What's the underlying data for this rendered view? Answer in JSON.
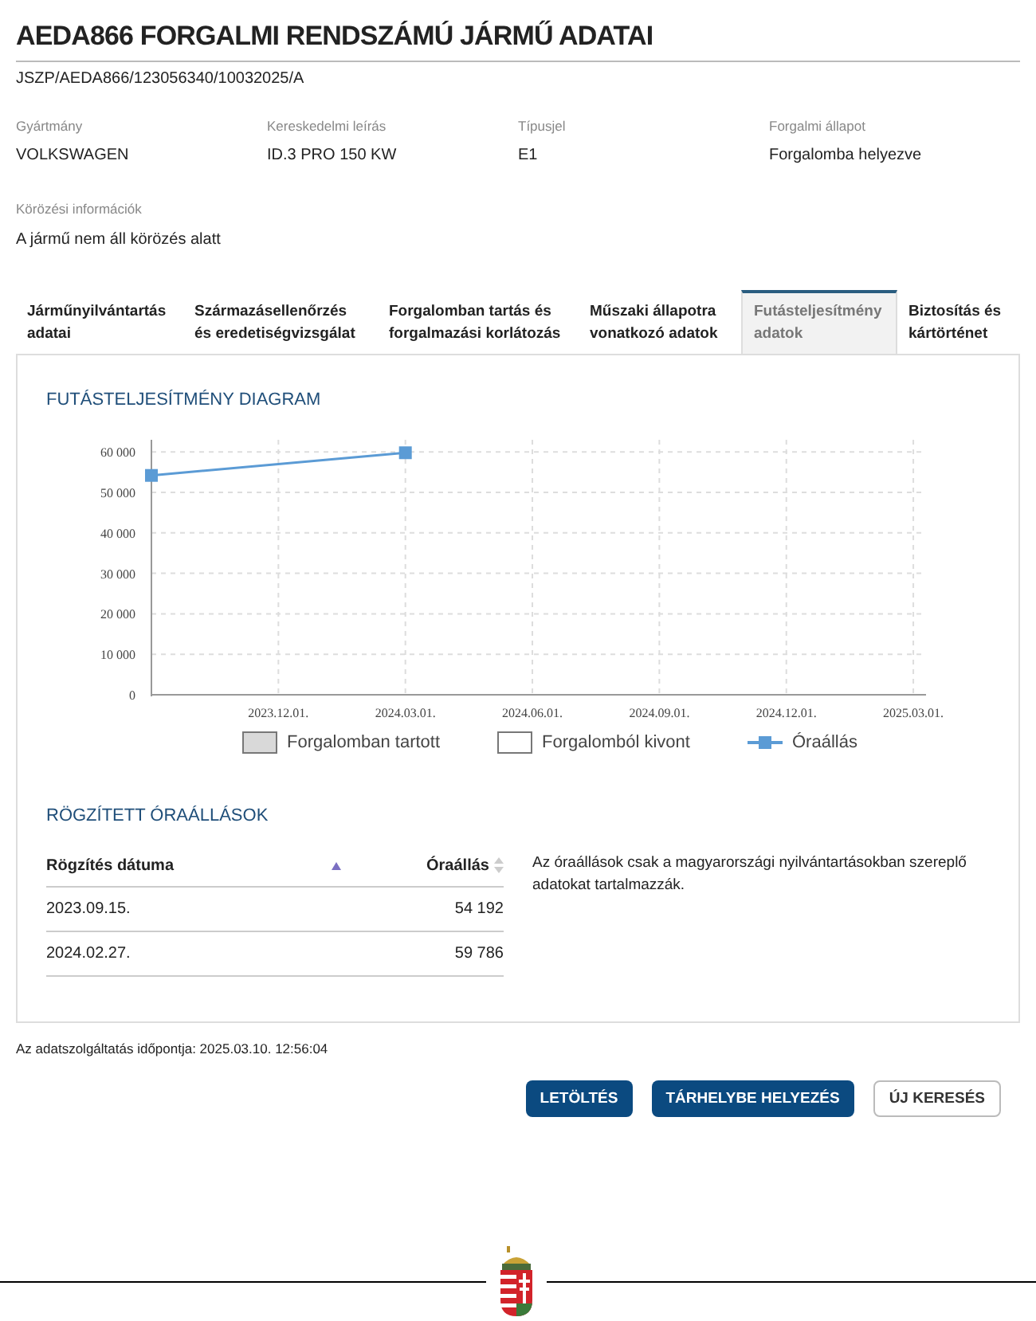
{
  "title": "AEDA866 FORGALMI RENDSZÁMÚ JÁRMŰ ADATAI",
  "reference": "JSZP/AEDA866/123056340/10032025/A",
  "fields": [
    {
      "label": "Gyártmány",
      "value": "VOLKSWAGEN"
    },
    {
      "label": "Kereskedelmi leírás",
      "value": "ID.3 PRO 150 KW"
    },
    {
      "label": "Típusjel",
      "value": "E1"
    },
    {
      "label": "Forgalmi állapot",
      "value": "Forgalomba helyezve"
    }
  ],
  "wanted_info": {
    "label": "Körözési információk",
    "value": "A jármű nem áll körözés alatt"
  },
  "tabs": [
    {
      "label": "Járműnyilvántartás adatai",
      "selected": false
    },
    {
      "label": "Származásellenőrzés és eredetiségvizsgálat",
      "selected": false
    },
    {
      "label": "Forgalomban tartás és forgalmazási korlátozás",
      "selected": false
    },
    {
      "label": "Műszaki állapotra vonatkozó adatok",
      "selected": false
    },
    {
      "label": "Futásteljesítmény adatok",
      "selected": true
    },
    {
      "label": "Biztosítás és kártörténet",
      "selected": false
    }
  ],
  "diagram": {
    "heading": "FUTÁSTELJESÍTMÉNY DIAGRAM",
    "legend": [
      {
        "label": "Forgalomban tartott",
        "kind": "filled"
      },
      {
        "label": "Forgalomból kivont",
        "kind": "outline"
      }
    ],
    "chart_data": {
      "type": "line",
      "grid": true,
      "categories": [
        null,
        null,
        null,
        "2023.12.01.",
        null,
        null,
        "2024.03.01.",
        null,
        null,
        "2024.06.01.",
        null,
        null,
        "2024.09.01.",
        null,
        null,
        "2024.12.01.",
        null,
        null,
        "2025.03.01."
      ],
      "ylim": [
        0,
        63000
      ],
      "yticks": [
        {
          "value": 0,
          "label": "0"
        },
        {
          "value": 10000,
          "label": "10 000"
        },
        {
          "value": 20000,
          "label": "20 000"
        },
        {
          "value": 30000,
          "label": "30 000"
        },
        {
          "value": 40000,
          "label": "40 000"
        },
        {
          "value": 50000,
          "label": "50 000"
        },
        {
          "value": 60000,
          "label": "60 000"
        }
      ],
      "series": [
        {
          "name": "Óraállás",
          "color": "#5b9bd5",
          "marker": "square",
          "values": [
            54200,
            null,
            null,
            null,
            null,
            null,
            59800,
            null,
            null,
            null,
            null,
            null,
            null,
            null,
            null,
            null,
            null,
            null,
            null
          ]
        }
      ]
    }
  },
  "readings": {
    "heading": "RÖGZÍTETT ÓRAÁLLÁSOK",
    "columns": [
      {
        "label": "Rögzítés dátuma",
        "sorted": true
      },
      {
        "label": "Óraállás",
        "sorted": false
      }
    ],
    "rows": [
      [
        "2023.09.15.",
        "54 192"
      ],
      [
        "2024.02.27.",
        "59 786"
      ]
    ],
    "note": "Az óraállások csak a magyarországi nyilvántartásokban szereplő adatokat tartalmazzák."
  },
  "timestamp": "Az adatszolgáltatás időpontja: 2025.03.10. 12:56:04",
  "buttons": [
    {
      "label": "LETÖLTÉS",
      "kind": "primary"
    },
    {
      "label": "TÁRHELYBE HELYEZÉS",
      "kind": "primary"
    },
    {
      "label": "ÚJ KERESÉS",
      "kind": "secondary"
    }
  ]
}
